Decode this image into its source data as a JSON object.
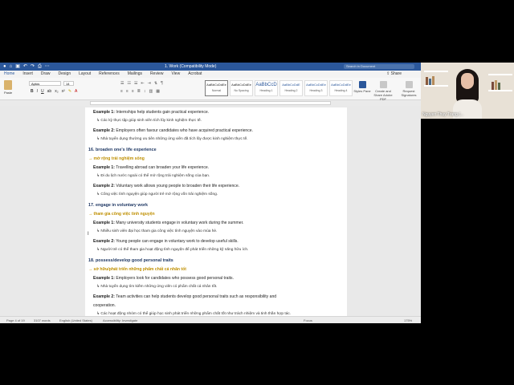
{
  "window": {
    "title": "1. Work (Compatibility Mode)",
    "search_placeholder": "Search in Document",
    "share_label": "Share"
  },
  "tabs": [
    "Home",
    "Insert",
    "Draw",
    "Design",
    "Layout",
    "References",
    "Mailings",
    "Review",
    "View",
    "Acrobat"
  ],
  "ribbon": {
    "paste_label": "Paste",
    "font_name": "Aptos",
    "font_size": "14",
    "styles": [
      {
        "sample": "AaBbCcDdEe",
        "name": "Normal"
      },
      {
        "sample": "AaBbCcDdEe",
        "name": "No Spacing"
      },
      {
        "sample": "AaBbCcD",
        "name": "Heading 1"
      },
      {
        "sample": "AaBbCcDdE",
        "name": "Heading 2"
      },
      {
        "sample": "AaBbCcDdEe",
        "name": "Heading 3"
      },
      {
        "sample": "AaBbCcDdEe",
        "name": "Heading 4"
      }
    ],
    "styles_pane": "Styles Pane",
    "create_pdf": "Create and Share Adobe PDF",
    "request_signatures": "Request Signatures"
  },
  "document": {
    "lines": [
      {
        "kind": "ex",
        "label": "Example 1:",
        "text": " Internships help students gain practical experience."
      },
      {
        "kind": "sub",
        "text": "↳ Các kỳ thực tập giúp sinh viên tích lũy kinh nghiệm thực tế."
      },
      {
        "kind": "ex",
        "label": "Example 2:",
        "text": " Employers often favour candidates who have acquired practical experience."
      },
      {
        "kind": "sub",
        "text": "↳ Nhà tuyển dụng thường ưu tiên những ứng viên đã tích lũy được kinh nghiệm thực tế."
      },
      {
        "kind": "head",
        "text": "16. broaden one's life experience"
      },
      {
        "kind": "viet",
        "text": "→ mở rộng trải nghiệm sống"
      },
      {
        "kind": "ex",
        "label": "Example 1:",
        "text": " Travelling abroad can broaden your life experience."
      },
      {
        "kind": "sub",
        "text": "↳ Đi du lịch nước ngoài có thể mở rộng trải nghiệm sống của bạn."
      },
      {
        "kind": "ex",
        "label": "Example 2:",
        "text": " Voluntary work allows young people to broaden their life experience."
      },
      {
        "kind": "sub",
        "text": "↳ Công việc tình nguyện giúp người trẻ mở rộng vốn trải nghiệm sống."
      },
      {
        "kind": "head",
        "text": "17. engage in voluntary work"
      },
      {
        "kind": "viet",
        "text": "→ tham gia công việc tình nguyện"
      },
      {
        "kind": "ex",
        "label": "Example 1:",
        "text": " Many university students engage in voluntary work during the summer."
      },
      {
        "kind": "sub",
        "text": "↳ Nhiều sinh viên đại học tham gia công việc tình nguyện vào mùa hè."
      },
      {
        "kind": "ex",
        "label": "Example 2:",
        "text": " Young people can engage in voluntary work to develop useful skills."
      },
      {
        "kind": "sub",
        "text": "↳ Người trẻ có thể tham gia hoạt động tình nguyện để phát triển những kỹ năng hữu ích."
      },
      {
        "kind": "head",
        "text": "18. possess/develop good personal traits"
      },
      {
        "kind": "viet",
        "text": "→ sở hữu/phát triển những phẩm chất cá nhân tốt"
      },
      {
        "kind": "ex",
        "label": "Example 1:",
        "text": " Employers look for candidates who possess good personal traits."
      },
      {
        "kind": "sub",
        "text": "↳ Nhà tuyển dụng tìm kiếm những ứng viên có phẩm chất cá nhân tốt."
      },
      {
        "kind": "ex",
        "label": "Example 2:",
        "text": " Team activities can help students develop good personal traits such as responsibility and"
      },
      {
        "kind": "ex",
        "label": "",
        "text": "cooperation."
      },
      {
        "kind": "sub",
        "text": "↳ Các hoạt động nhóm có thể giúp học sinh phát triển những phẩm chất tốt như trách nhiệm và tinh thần hợp tác."
      },
      {
        "kind": "head",
        "text": "19. prepare somebody for something/to do something"
      }
    ]
  },
  "status": {
    "page": "Page 4 of 19",
    "words": "3107 words",
    "language": "English (United States)",
    "accessibility": "Accessibility: Investigate",
    "focus": "Focus",
    "zoom": "175%"
  },
  "webcam": {
    "name": "Nguyen Thuy Trang (..."
  }
}
